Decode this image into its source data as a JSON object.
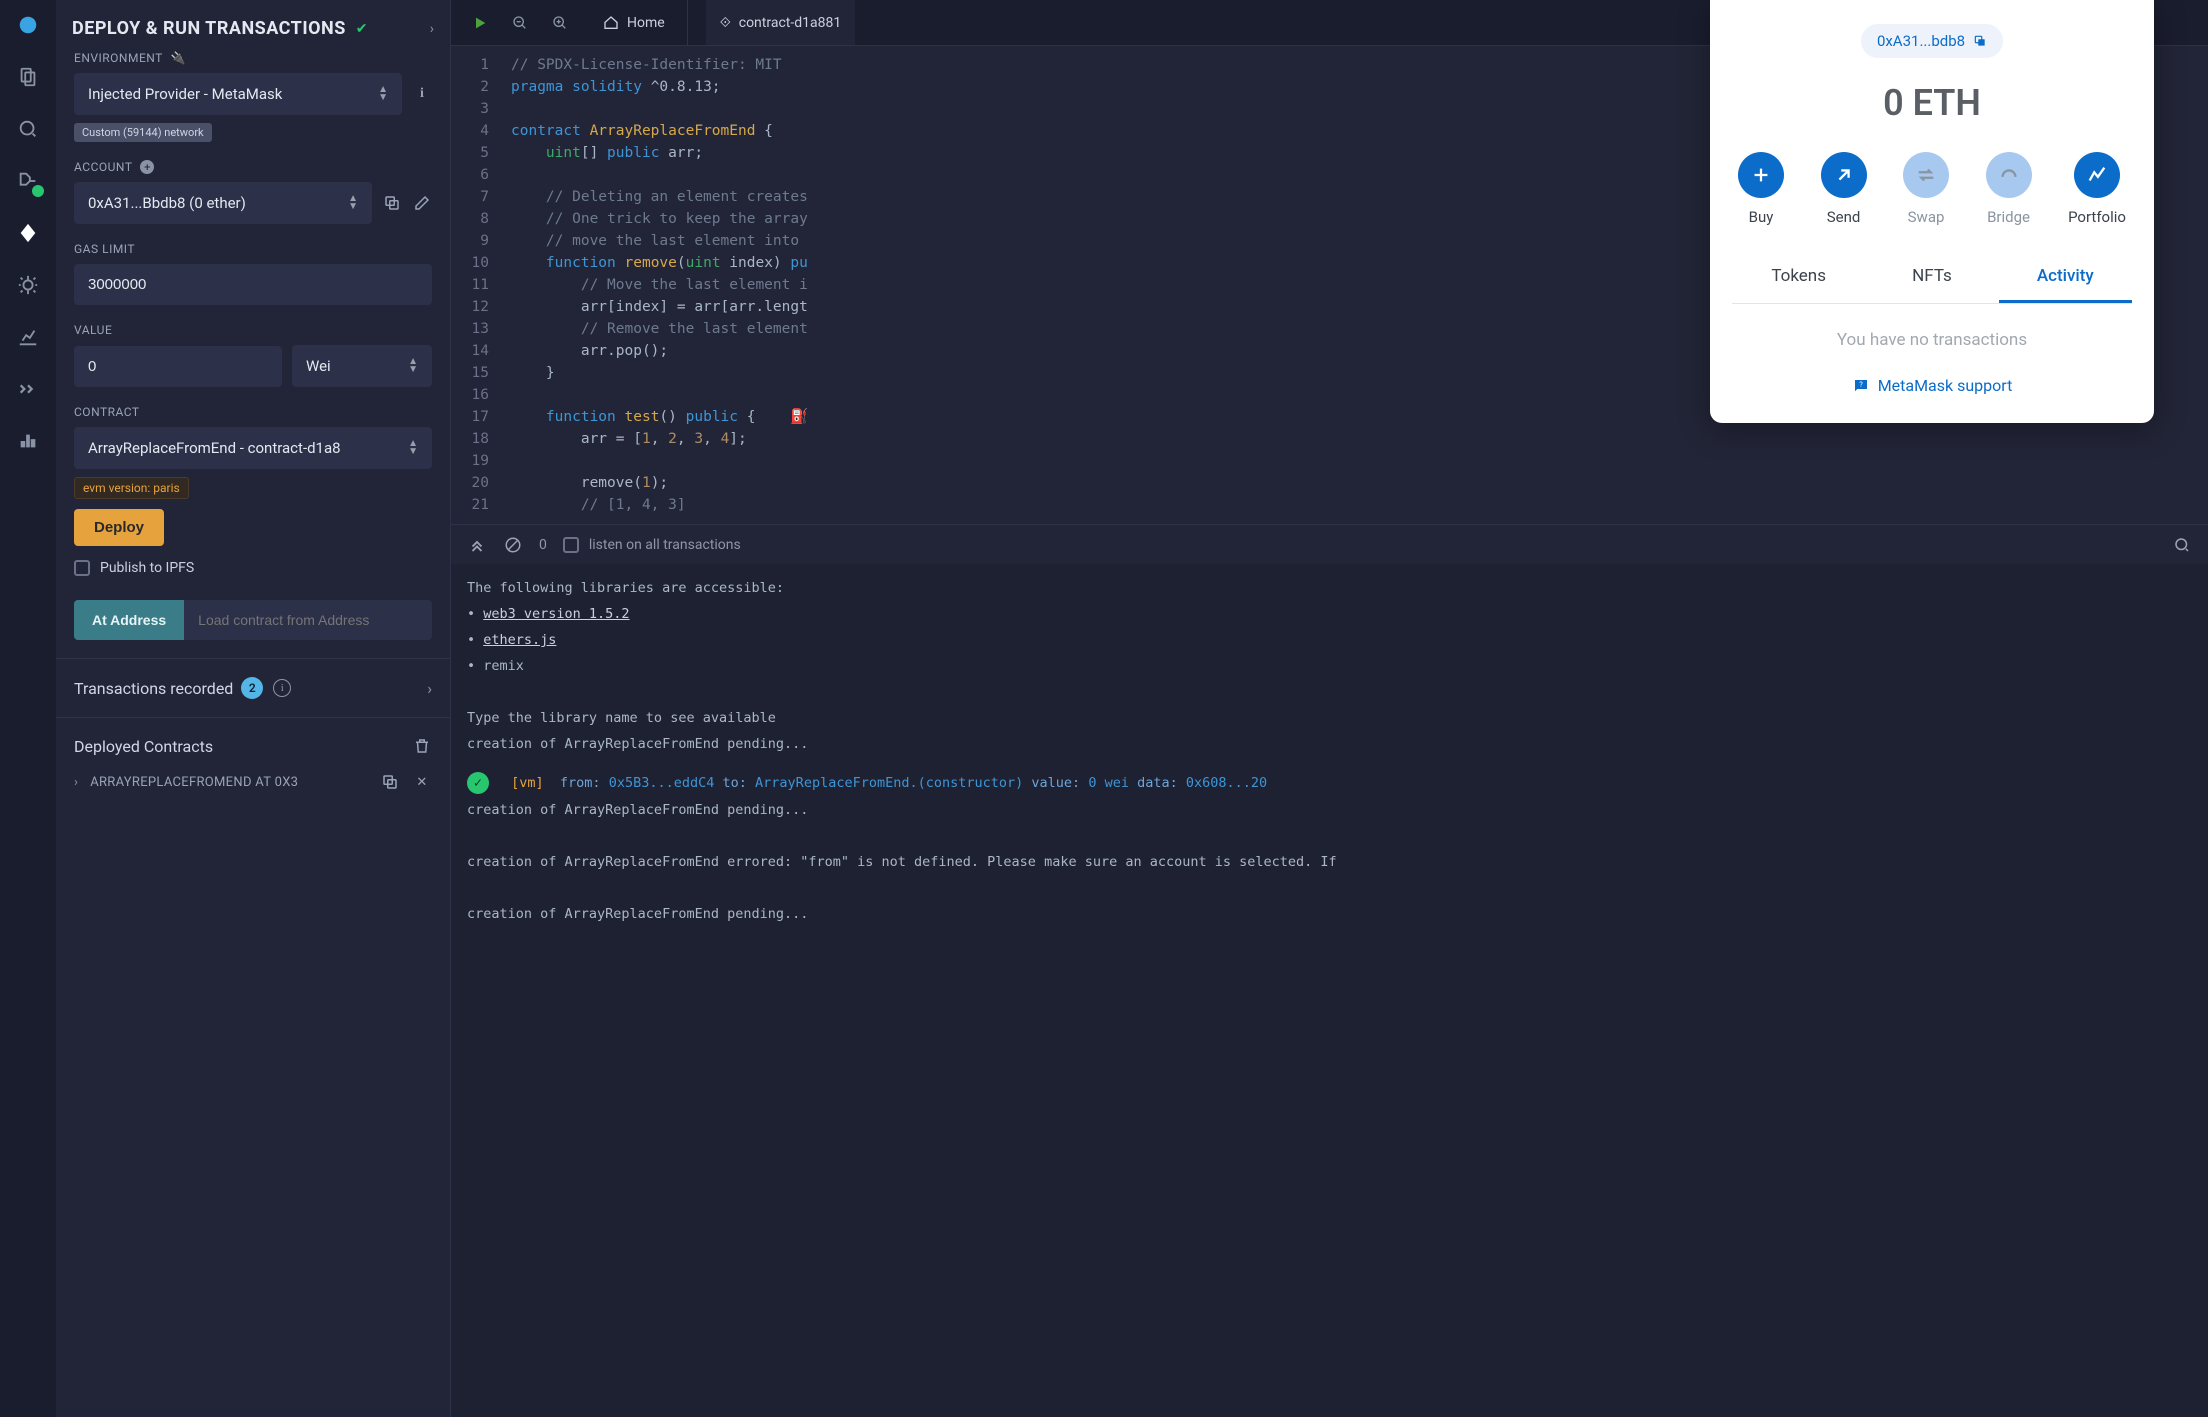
{
  "panel": {
    "title": "DEPLOY & RUN TRANSACTIONS",
    "env_label": "ENVIRONMENT",
    "env_value": "Injected Provider - MetaMask",
    "env_chip": "Custom (59144) network",
    "account_label": "ACCOUNT",
    "account_value": "0xA31...Bbdb8 (0 ether)",
    "gas_label": "GAS LIMIT",
    "gas_value": "3000000",
    "value_label": "VALUE",
    "value_amount": "0",
    "value_unit": "Wei",
    "contract_label": "CONTRACT",
    "contract_value": "ArrayReplaceFromEnd - contract-d1a8",
    "evm_chip": "evm version: paris",
    "deploy_btn": "Deploy",
    "ipfs_label": "Publish to IPFS",
    "at_address_btn": "At Address",
    "at_address_placeholder": "Load contract from Address",
    "tx_recorded_label": "Transactions recorded",
    "tx_recorded_count": "2",
    "deployed_label": "Deployed Contracts",
    "deployed_item": "ARRAYREPLACEFROMEND AT 0X3"
  },
  "tabs": {
    "home": "Home",
    "file": "contract-d1a881"
  },
  "code_lines": [
    {
      "n": "1",
      "html": "<span class='tok-cm'>// SPDX-License-Identifier: MIT</span>"
    },
    {
      "n": "2",
      "html": "<span class='tok-kw'>pragma</span> <span class='tok-kw'>solidity</span> ^0.8.13;"
    },
    {
      "n": "3",
      "html": ""
    },
    {
      "n": "4",
      "html": "<span class='tok-kw'>contract</span> <span class='tok-fn'>ArrayReplaceFromEnd</span> {"
    },
    {
      "n": "5",
      "html": "    <span class='tok-ty'>uint</span>[] <span class='tok-kw'>public</span> arr;"
    },
    {
      "n": "6",
      "html": ""
    },
    {
      "n": "7",
      "html": "    <span class='tok-cm'>// Deleting an element creates</span>"
    },
    {
      "n": "8",
      "html": "    <span class='tok-cm'>// One trick to keep the array</span>"
    },
    {
      "n": "9",
      "html": "    <span class='tok-cm'>// move the last element into </span>"
    },
    {
      "n": "10",
      "html": "    <span class='tok-kw'>function</span> <span class='tok-fn'>remove</span>(<span class='tok-ty'>uint</span> index) <span class='tok-kw'>pu</span>"
    },
    {
      "n": "11",
      "html": "        <span class='tok-cm'>// Move the last element i</span>"
    },
    {
      "n": "12",
      "html": "        arr[index] = arr[arr.lengt"
    },
    {
      "n": "13",
      "html": "        <span class='tok-cm'>// Remove the last element</span>"
    },
    {
      "n": "14",
      "html": "        arr.pop();"
    },
    {
      "n": "15",
      "html": "    }"
    },
    {
      "n": "16",
      "html": ""
    },
    {
      "n": "17",
      "html": "    <span class='tok-kw'>function</span> <span class='tok-fn'>test</span>() <span class='tok-kw'>public</span> {    <span class='run-indicator'>⛽</span>"
    },
    {
      "n": "18",
      "html": "        arr = [<span class='tok-nm'>1</span>, <span class='tok-nm'>2</span>, <span class='tok-nm'>3</span>, <span class='tok-nm'>4</span>];"
    },
    {
      "n": "19",
      "html": ""
    },
    {
      "n": "20",
      "html": "        remove(<span class='tok-nm'>1</span>);"
    },
    {
      "n": "21",
      "html": "        <span class='tok-cm'>// [1, 4, 3]</span>"
    }
  ],
  "terminal": {
    "listen_label": "listen on all transactions",
    "pending_count": "0",
    "lines_top": [
      "The following libraries are accessible:",
      "• <a>web3 version 1.5.2</a>",
      "• <a>ethers.js</a>",
      "• remix",
      "",
      "Type the library name to see available ",
      "creation of ArrayReplaceFromEnd pending..."
    ],
    "tx_line": "<span class='check-circle'>✓</span> <span class='tk-vm'>[vm]</span>  <span class='tk-key'>from:</span> <span class='tk-acc'>0x5B3...eddC4</span> <span class='tk-key'>to:</span> <span class='tk-acc'>ArrayReplaceFromEnd.(constructor)</span> <span class='tk-key'>value:</span> <span class='tk-acc'>0 wei</span> <span class='tk-key'>data:</span> <span class='tk-acc'>0x608...20</span>",
    "lines_bottom": [
      "creation of ArrayReplaceFromEnd pending...",
      "",
      "creation of ArrayReplaceFromEnd errored: \"from\" is not defined. Please make sure an account is selected. If",
      "",
      "creation of ArrayReplaceFromEnd pending..."
    ]
  },
  "metamask": {
    "address": "0xA31...bdb8",
    "balance": "0 ETH",
    "actions": {
      "buy": {
        "label": "Buy",
        "enabled": true
      },
      "send": {
        "label": "Send",
        "enabled": true
      },
      "swap": {
        "label": "Swap",
        "enabled": false
      },
      "bridge": {
        "label": "Bridge",
        "enabled": false
      },
      "portfolio": {
        "label": "Portfolio",
        "enabled": true
      }
    },
    "tabs": {
      "tokens": "Tokens",
      "nfts": "NFTs",
      "activity": "Activity"
    },
    "empty": "You have no transactions",
    "support": "MetaMask support"
  }
}
